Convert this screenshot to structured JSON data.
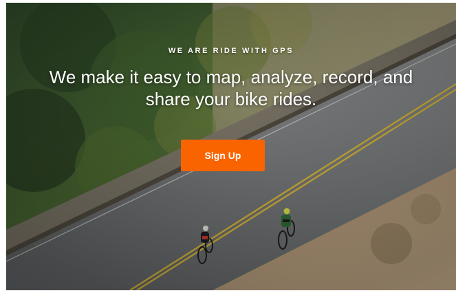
{
  "hero": {
    "eyebrow": "WE ARE RIDE WITH GPS",
    "headline": "We make it easy to map, analyze, record, and share your bike rides.",
    "signup_label": "Sign Up",
    "accent_color": "#fa6400"
  }
}
